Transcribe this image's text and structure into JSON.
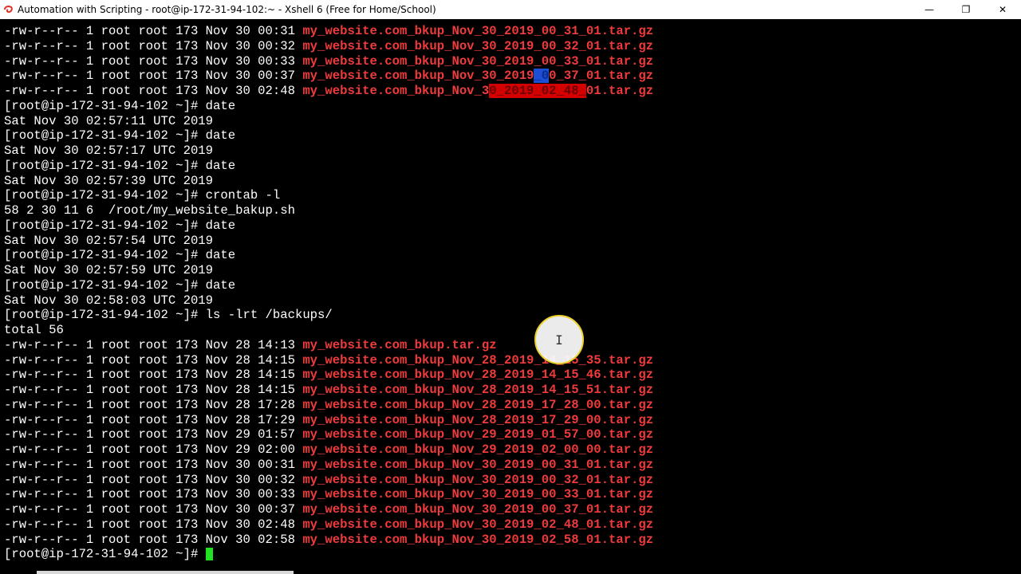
{
  "window": {
    "title": "Automation with Scripting - root@ip-172-31-94-102:~ - Xshell 6 (Free for Home/School)",
    "controls": {
      "minimize": "—",
      "restore": "❐",
      "close": "✕"
    }
  },
  "terminal": {
    "prompt": "[root@ip-172-31-94-102 ~]# ",
    "lines": [
      {
        "type": "file",
        "meta": "-rw-r--r-- 1 root root 173 Nov 30 00:31 ",
        "name": "my_website.com_bkup_Nov_30_2019_00_31_01.tar.gz"
      },
      {
        "type": "file",
        "meta": "-rw-r--r-- 1 root root 173 Nov 30 00:32 ",
        "name": "my_website.com_bkup_Nov_30_2019_00_32_01.tar.gz"
      },
      {
        "type": "file",
        "meta": "-rw-r--r-- 1 root root 173 Nov 30 00:33 ",
        "name": "my_website.com_bkup_Nov_30_2019_00_33_01.tar.gz"
      },
      {
        "type": "file",
        "meta": "-rw-r--r-- 1 root root 173 Nov 30 00:37 ",
        "name": "my_website.com_bkup_Nov_30_2019_00_37_01.tar.gz",
        "hl": {
          "start": 31,
          "end": 33,
          "color": "blue"
        }
      },
      {
        "type": "file",
        "meta": "-rw-r--r-- 1 root root 173 Nov 30 02:48 ",
        "name": "my_website.com_bkup_Nov_30_2019_02_48_01.tar.gz",
        "hl": {
          "start": 25,
          "end": 38,
          "color": "red"
        }
      },
      {
        "type": "prompt",
        "cmd": "date"
      },
      {
        "type": "out",
        "text": "Sat Nov 30 02:57:11 UTC 2019"
      },
      {
        "type": "prompt",
        "cmd": "date"
      },
      {
        "type": "out",
        "text": "Sat Nov 30 02:57:17 UTC 2019"
      },
      {
        "type": "prompt",
        "cmd": "date"
      },
      {
        "type": "out",
        "text": "Sat Nov 30 02:57:39 UTC 2019"
      },
      {
        "type": "prompt",
        "cmd": "crontab -l"
      },
      {
        "type": "out",
        "text": "58 2 30 11 6  /root/my_website_bakup.sh"
      },
      {
        "type": "prompt",
        "cmd": "date"
      },
      {
        "type": "out",
        "text": "Sat Nov 30 02:57:54 UTC 2019"
      },
      {
        "type": "prompt",
        "cmd": "date"
      },
      {
        "type": "out",
        "text": "Sat Nov 30 02:57:59 UTC 2019"
      },
      {
        "type": "prompt",
        "cmd": "date"
      },
      {
        "type": "out",
        "text": "Sat Nov 30 02:58:03 UTC 2019"
      },
      {
        "type": "prompt",
        "cmd": "ls -lrt /backups/"
      },
      {
        "type": "out",
        "text": "total 56"
      },
      {
        "type": "file",
        "meta": "-rw-r--r-- 1 root root 173 Nov 28 14:13 ",
        "name": "my_website.com_bkup.tar.gz"
      },
      {
        "type": "file",
        "meta": "-rw-r--r-- 1 root root 173 Nov 28 14:15 ",
        "name": "my_website.com_bkup_Nov_28_2019_14_15_35.tar.gz"
      },
      {
        "type": "file",
        "meta": "-rw-r--r-- 1 root root 173 Nov 28 14:15 ",
        "name": "my_website.com_bkup_Nov_28_2019_14_15_46.tar.gz"
      },
      {
        "type": "file",
        "meta": "-rw-r--r-- 1 root root 173 Nov 28 14:15 ",
        "name": "my_website.com_bkup_Nov_28_2019_14_15_51.tar.gz"
      },
      {
        "type": "file",
        "meta": "-rw-r--r-- 1 root root 173 Nov 28 17:28 ",
        "name": "my_website.com_bkup_Nov_28_2019_17_28_00.tar.gz"
      },
      {
        "type": "file",
        "meta": "-rw-r--r-- 1 root root 173 Nov 28 17:29 ",
        "name": "my_website.com_bkup_Nov_28_2019_17_29_00.tar.gz"
      },
      {
        "type": "file",
        "meta": "-rw-r--r-- 1 root root 173 Nov 29 01:57 ",
        "name": "my_website.com_bkup_Nov_29_2019_01_57_00.tar.gz"
      },
      {
        "type": "file",
        "meta": "-rw-r--r-- 1 root root 173 Nov 29 02:00 ",
        "name": "my_website.com_bkup_Nov_29_2019_02_00_00.tar.gz"
      },
      {
        "type": "file",
        "meta": "-rw-r--r-- 1 root root 173 Nov 30 00:31 ",
        "name": "my_website.com_bkup_Nov_30_2019_00_31_01.tar.gz"
      },
      {
        "type": "file",
        "meta": "-rw-r--r-- 1 root root 173 Nov 30 00:32 ",
        "name": "my_website.com_bkup_Nov_30_2019_00_32_01.tar.gz"
      },
      {
        "type": "file",
        "meta": "-rw-r--r-- 1 root root 173 Nov 30 00:33 ",
        "name": "my_website.com_bkup_Nov_30_2019_00_33_01.tar.gz"
      },
      {
        "type": "file",
        "meta": "-rw-r--r-- 1 root root 173 Nov 30 00:37 ",
        "name": "my_website.com_bkup_Nov_30_2019_00_37_01.tar.gz"
      },
      {
        "type": "file",
        "meta": "-rw-r--r-- 1 root root 173 Nov 30 02:48 ",
        "name": "my_website.com_bkup_Nov_30_2019_02_48_01.tar.gz"
      },
      {
        "type": "file",
        "meta": "-rw-r--r-- 1 root root 173 Nov 30 02:58 ",
        "name": "my_website.com_bkup_Nov_30_2019_02_58_01.tar.gz"
      },
      {
        "type": "prompt",
        "cmd": "",
        "cursor": true
      }
    ]
  },
  "mouse_cursor": {
    "glyph": "I"
  },
  "colors": {
    "filename": "#ef3b3b",
    "cursor": "#22e022",
    "text": "#ffffff",
    "background": "#000000"
  }
}
